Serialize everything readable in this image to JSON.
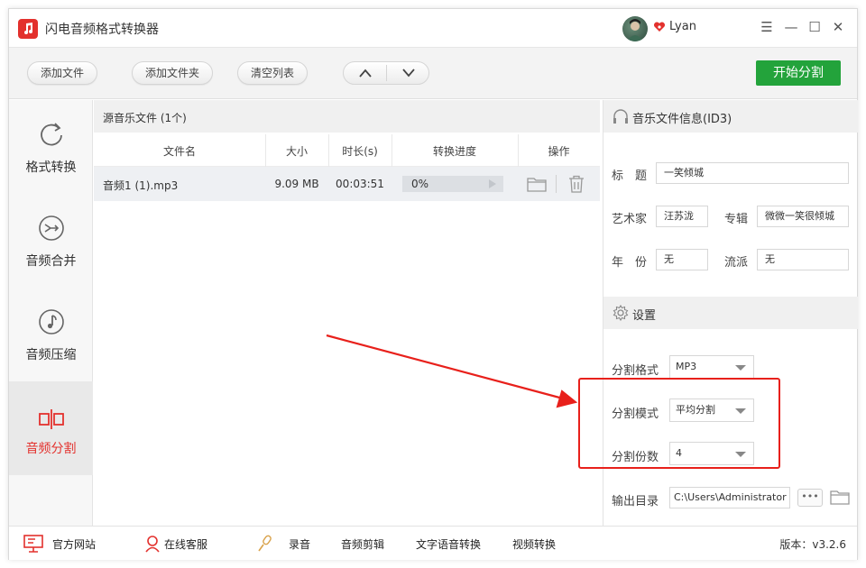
{
  "app": {
    "title": "闪电音频格式转换器",
    "username": "Lyan",
    "brand_color": "#e3312d",
    "accent_green": "#23a33b"
  },
  "window_controls": [
    "☰",
    "—",
    "☐",
    "✕"
  ],
  "toolbar": {
    "add_file": "添加文件",
    "add_folder": "添加文件夹",
    "clear_list": "清空列表",
    "start_split": "开始分割"
  },
  "sidebar": {
    "items": [
      {
        "label": "格式转换",
        "icon": "refresh-icon",
        "active": false
      },
      {
        "label": "音频合并",
        "icon": "merge-icon",
        "active": false
      },
      {
        "label": "音频压缩",
        "icon": "music-note-icon",
        "active": false
      },
      {
        "label": "音频分割",
        "icon": "split-icon",
        "active": true
      }
    ]
  },
  "files": {
    "section_title": "源音乐文件 (1个)",
    "columns": [
      "文件名",
      "大小",
      "时长(s)",
      "转换进度",
      "操作"
    ],
    "rows": [
      {
        "name": "音频1 (1).mp3",
        "size": "9.09 MB",
        "duration": "00:03:51",
        "progress_text": "0%",
        "progress": 0
      }
    ]
  },
  "music_info": {
    "section_title": "音乐文件信息(ID3)",
    "title_label": "标　题",
    "title_value": "一笑倾城",
    "artist_label": "艺术家",
    "artist_value": "汪苏泷",
    "album_label": "专辑",
    "album_value": "微微一笑很倾城",
    "year_label": "年　份",
    "year_value": "无",
    "genre_label": "流派",
    "genre_value": "无"
  },
  "settings": {
    "section_title": "设置",
    "format_label": "分割格式",
    "format_value": "MP3",
    "mode_label": "分割模式",
    "mode_value": "平均分割",
    "count_label": "分割份数",
    "count_value": "4",
    "output_label": "输出目录",
    "output_value": "C:\\Users\\Administrator",
    "browse_label": "•••"
  },
  "statusbar": {
    "website": "官方网站",
    "support": "在线客服",
    "record": "录音",
    "audio_edit": "音频剪辑",
    "tts": "文字语音转换",
    "video_convert": "视频转换",
    "version": "版本：v3.2.6"
  }
}
